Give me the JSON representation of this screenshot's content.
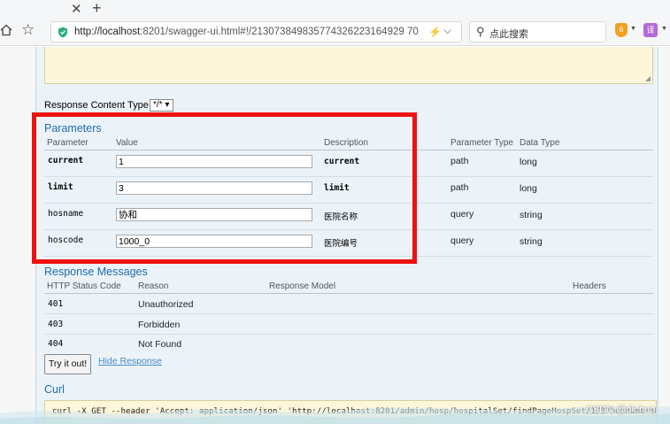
{
  "browser": {
    "url_host": "http://localhost",
    "url_rest": ":8201/swagger-ui.html#!/213073849835774326223164929 70",
    "search_text": "点此搜索",
    "ext1_label": "6",
    "ext2_label": "译"
  },
  "response_content_type": {
    "label": "Response Content Type",
    "value": "*/*"
  },
  "parameters": {
    "title": "Parameters",
    "headers": [
      "Parameter",
      "Value",
      "Description",
      "Parameter Type",
      "Data Type"
    ],
    "rows": [
      {
        "name": "current",
        "value": "1",
        "description": "current",
        "param_type": "path",
        "data_type": "long"
      },
      {
        "name": "limit",
        "value": "3",
        "description": "limit",
        "param_type": "path",
        "data_type": "long"
      },
      {
        "name": "hosname",
        "value": "协和",
        "description": "医院名称",
        "param_type": "query",
        "data_type": "string"
      },
      {
        "name": "hoscode",
        "value": "1000_0",
        "description": "医院编号",
        "param_type": "query",
        "data_type": "string"
      }
    ]
  },
  "response_messages": {
    "title": "Response Messages",
    "headers": [
      "HTTP Status Code",
      "Reason",
      "Response Model",
      "Headers"
    ],
    "rows": [
      {
        "code": "401",
        "reason": "Unauthorized"
      },
      {
        "code": "403",
        "reason": "Forbidden"
      },
      {
        "code": "404",
        "reason": "Not Found"
      }
    ]
  },
  "actions": {
    "try_label": "Try it out!",
    "hide_label": "Hide Response"
  },
  "curl": {
    "title": "Curl",
    "command": "curl -X GET --header 'Accept: application/json' 'http://localhost:8201/admin/hosp/hospitalSet/findPageHospSet/1/3?hosname=%E5%8D%8F%E5%92"
  },
  "watermark": "CSDN @dk.huo"
}
